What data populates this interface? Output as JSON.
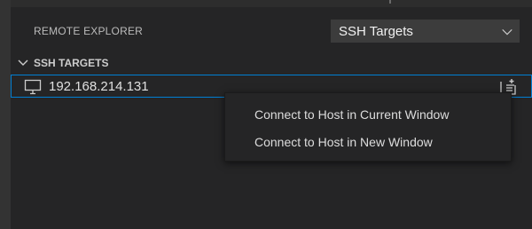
{
  "remote_explorer": {
    "title": "REMOTE EXPLORER",
    "selected_target_type": "SSH Targets"
  },
  "section": {
    "label": "SSH TARGETS"
  },
  "host": {
    "label": "192.168.214.131"
  },
  "context_menu": {
    "items": [
      {
        "label": "Connect to Host in Current Window"
      },
      {
        "label": "Connect to Host in New Window"
      }
    ]
  },
  "colors": {
    "background": "#252526",
    "focus_border": "#007fd4",
    "dropdown_bg": "#3c3c3c"
  },
  "icons": {
    "host": "monitor-icon",
    "action": "open-in-new-window-icon",
    "section_toggle": "chevron-down-icon",
    "dropdown": "chevron-down-icon"
  }
}
